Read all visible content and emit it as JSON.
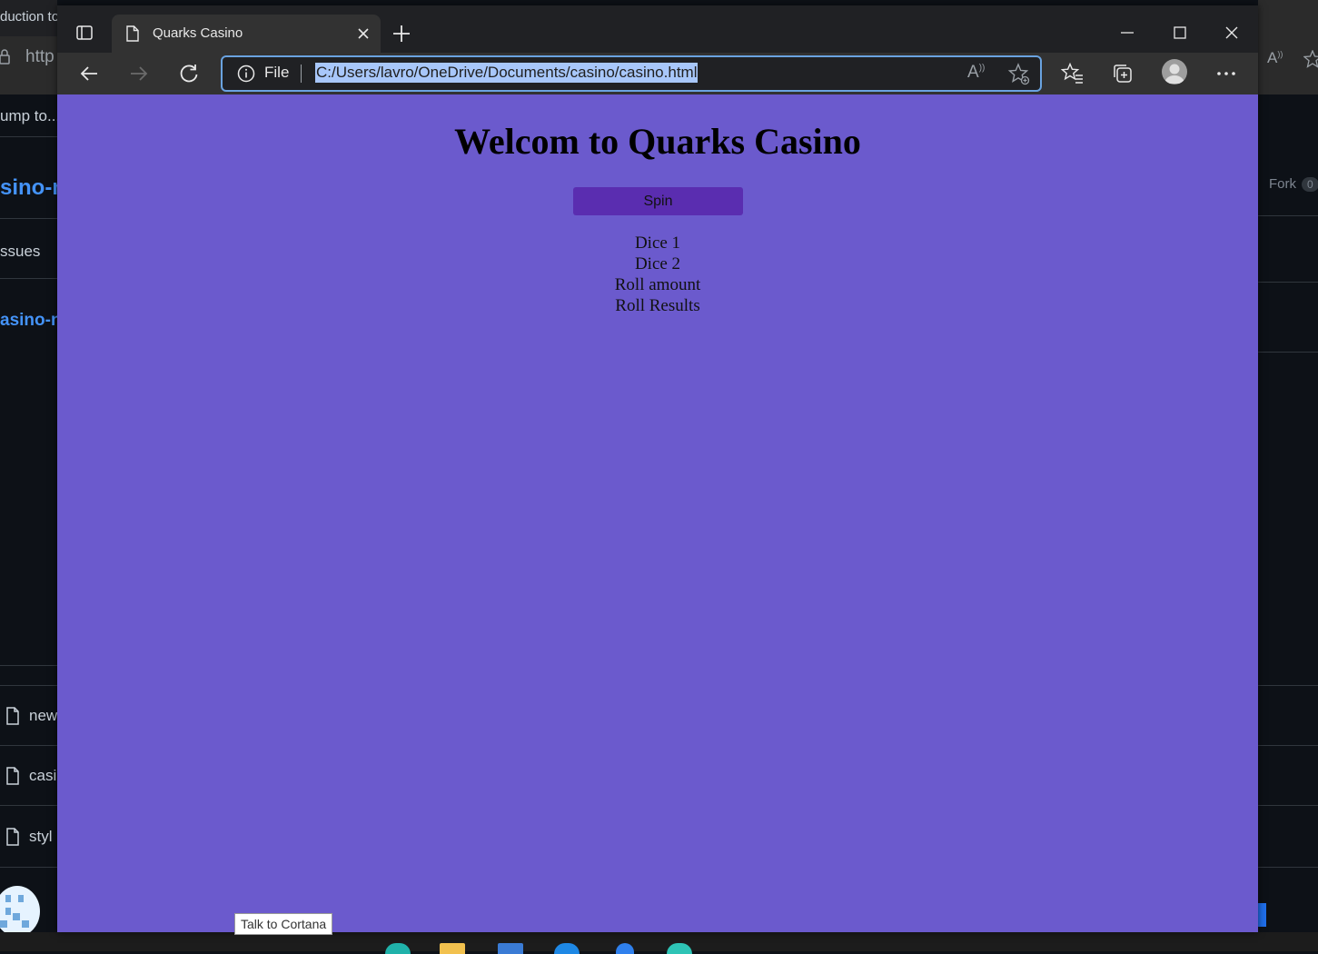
{
  "background": {
    "left_fragments": {
      "tab_text": "duction to",
      "url_text": "http",
      "jump_text": "ump to...",
      "repo_link": "sino-n",
      "issues_text": "ssues",
      "repo_link_2": "asino-n",
      "files": [
        "new",
        "casi",
        "styl"
      ]
    },
    "right_fragments": {
      "fork_label": "Fork",
      "fork_count": "0"
    },
    "tooltip": "Talk to Cortana"
  },
  "browser": {
    "tab_title": "Quarks Casino",
    "address": {
      "scheme_label": "File",
      "url": "C:/Users/lavro/OneDrive/Documents/casino/casino.html"
    }
  },
  "page": {
    "title": "Welcom to Quarks Casino",
    "spin_label": "Spin",
    "results": {
      "dice1": "Dice 1",
      "dice2": "Dice 2",
      "roll_amount": "Roll amount",
      "roll_results": "Roll Results"
    }
  },
  "colors": {
    "page_background": "#6b5acd",
    "spin_button": "#5a2db0",
    "address_highlight": "#a8c7fa",
    "browser_chrome": "#202124"
  }
}
